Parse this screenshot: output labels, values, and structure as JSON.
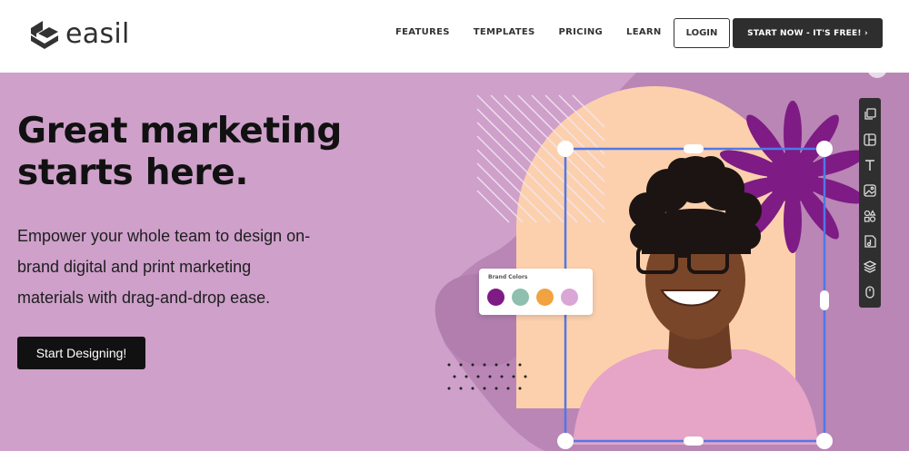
{
  "brand": {
    "name": "easil"
  },
  "nav": {
    "links": [
      "FEATURES",
      "TEMPLATES",
      "PRICING",
      "LEARN"
    ],
    "login": "LOGIN",
    "start_now": "START NOW - IT'S FREE! ›"
  },
  "hero": {
    "headline": "Great marketing starts here.",
    "subtext": "Empower your whole team to design on-brand digital and print marketing materials with drag-and-drop ease.",
    "cta": "Start Designing!"
  },
  "brand_card": {
    "title": "Brand Colors",
    "swatches": [
      "#7e1b84",
      "#8fbfae",
      "#f0a33f",
      "#d9a6d6"
    ]
  },
  "colors": {
    "hero_bg": "#cea0ca",
    "accent_purple": "#7e1b84",
    "peach": "#fcd0ad",
    "selection_blue": "#4f79e8"
  },
  "toolbar": {
    "tools": [
      "layers-icon",
      "layout-icon",
      "text-icon",
      "image-icon",
      "shapes-icon",
      "music-icon",
      "stack-icon",
      "mouse-icon"
    ]
  }
}
